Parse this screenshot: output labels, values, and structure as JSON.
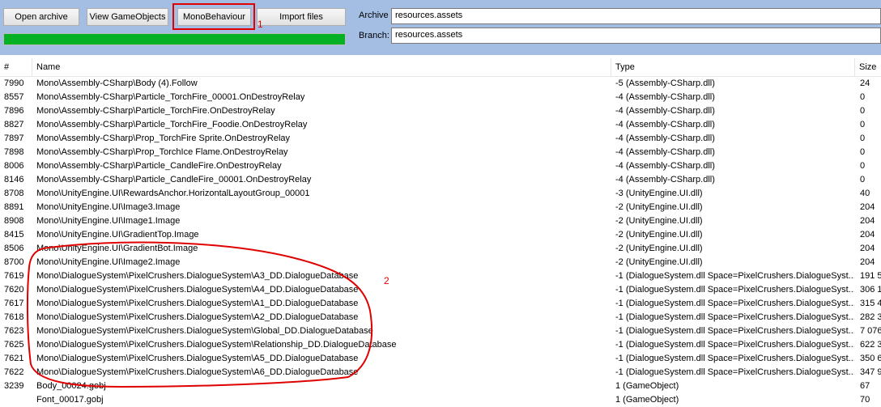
{
  "toolbar": {
    "open_archive": "Open archive",
    "view_gameobjects": "View GameObjects",
    "monobehaviour": "MonoBehaviour",
    "import_files": "Import files",
    "progress": 1.0,
    "archive_label": "Archive",
    "archive_value": "resources.assets",
    "branch_label": "Branch:",
    "branch_value": "resources.assets"
  },
  "table": {
    "headers": [
      "#",
      "Name",
      "Type",
      "Size"
    ],
    "rows": [
      [
        "7990",
        "Mono\\Assembly-CSharp\\Body (4).Follow",
        "-5 (Assembly-CSharp.dll)",
        "24"
      ],
      [
        "8557",
        "Mono\\Assembly-CSharp\\Particle_TorchFire_00001.OnDestroyRelay",
        "-4 (Assembly-CSharp.dll)",
        "0"
      ],
      [
        "7896",
        "Mono\\Assembly-CSharp\\Particle_TorchFire.OnDestroyRelay",
        "-4 (Assembly-CSharp.dll)",
        "0"
      ],
      [
        "8827",
        "Mono\\Assembly-CSharp\\Particle_TorchFire_Foodie.OnDestroyRelay",
        "-4 (Assembly-CSharp.dll)",
        "0"
      ],
      [
        "7897",
        "Mono\\Assembly-CSharp\\Prop_TorchFire Sprite.OnDestroyRelay",
        "-4 (Assembly-CSharp.dll)",
        "0"
      ],
      [
        "7898",
        "Mono\\Assembly-CSharp\\Prop_TorchIce Flame.OnDestroyRelay",
        "-4 (Assembly-CSharp.dll)",
        "0"
      ],
      [
        "8006",
        "Mono\\Assembly-CSharp\\Particle_CandleFire.OnDestroyRelay",
        "-4 (Assembly-CSharp.dll)",
        "0"
      ],
      [
        "8146",
        "Mono\\Assembly-CSharp\\Particle_CandleFire_00001.OnDestroyRelay",
        "-4 (Assembly-CSharp.dll)",
        "0"
      ],
      [
        "8708",
        "Mono\\UnityEngine.UI\\RewardsAnchor.HorizontalLayoutGroup_00001",
        "-3 (UnityEngine.UI.dll)",
        "40"
      ],
      [
        "8891",
        "Mono\\UnityEngine.UI\\Image3.Image",
        "-2 (UnityEngine.UI.dll)",
        "204"
      ],
      [
        "8908",
        "Mono\\UnityEngine.UI\\Image1.Image",
        "-2 (UnityEngine.UI.dll)",
        "204"
      ],
      [
        "8415",
        "Mono\\UnityEngine.UI\\GradientTop.Image",
        "-2 (UnityEngine.UI.dll)",
        "204"
      ],
      [
        "8506",
        "Mono\\UnityEngine.UI\\GradientBot.Image",
        "-2 (UnityEngine.UI.dll)",
        "204"
      ],
      [
        "8700",
        "Mono\\UnityEngine.UI\\Image2.Image",
        "-2 (UnityEngine.UI.dll)",
        "204"
      ],
      [
        "7619",
        "Mono\\DialogueSystem\\PixelCrushers.DialogueSystem\\A3_DD.DialogueDatabase",
        "-1 (DialogueSystem.dll   Space=PixelCrushers.DialogueSyst...",
        "191 5"
      ],
      [
        "7620",
        "Mono\\DialogueSystem\\PixelCrushers.DialogueSystem\\A4_DD.DialogueDatabase",
        "-1 (DialogueSystem.dll   Space=PixelCrushers.DialogueSyst...",
        "306 1"
      ],
      [
        "7617",
        "Mono\\DialogueSystem\\PixelCrushers.DialogueSystem\\A1_DD.DialogueDatabase",
        "-1 (DialogueSystem.dll   Space=PixelCrushers.DialogueSyst...",
        "315 4"
      ],
      [
        "7618",
        "Mono\\DialogueSystem\\PixelCrushers.DialogueSystem\\A2_DD.DialogueDatabase",
        "-1 (DialogueSystem.dll   Space=PixelCrushers.DialogueSyst...",
        "282 3"
      ],
      [
        "7623",
        "Mono\\DialogueSystem\\PixelCrushers.DialogueSystem\\Global_DD.DialogueDatabase",
        "-1 (DialogueSystem.dll   Space=PixelCrushers.DialogueSyst...",
        "7 076"
      ],
      [
        "7625",
        "Mono\\DialogueSystem\\PixelCrushers.DialogueSystem\\Relationship_DD.DialogueDatabase",
        "-1 (DialogueSystem.dll   Space=PixelCrushers.DialogueSyst...",
        "622 3"
      ],
      [
        "7621",
        "Mono\\DialogueSystem\\PixelCrushers.DialogueSystem\\A5_DD.DialogueDatabase",
        "-1 (DialogueSystem.dll   Space=PixelCrushers.DialogueSyst...",
        "350 6"
      ],
      [
        "7622",
        "Mono\\DialogueSystem\\PixelCrushers.DialogueSystem\\A6_DD.DialogueDatabase",
        "-1 (DialogueSystem.dll   Space=PixelCrushers.DialogueSyst...",
        "347 9"
      ],
      [
        "3239",
        "Body_00024.gobj",
        "1 (GameObject)",
        "67"
      ],
      [
        "",
        "Font_00017.gobj",
        "1 (GameObject)",
        "70"
      ]
    ]
  },
  "annotations": {
    "marker_1": "1",
    "marker_2": "2",
    "color": "#e00000"
  }
}
